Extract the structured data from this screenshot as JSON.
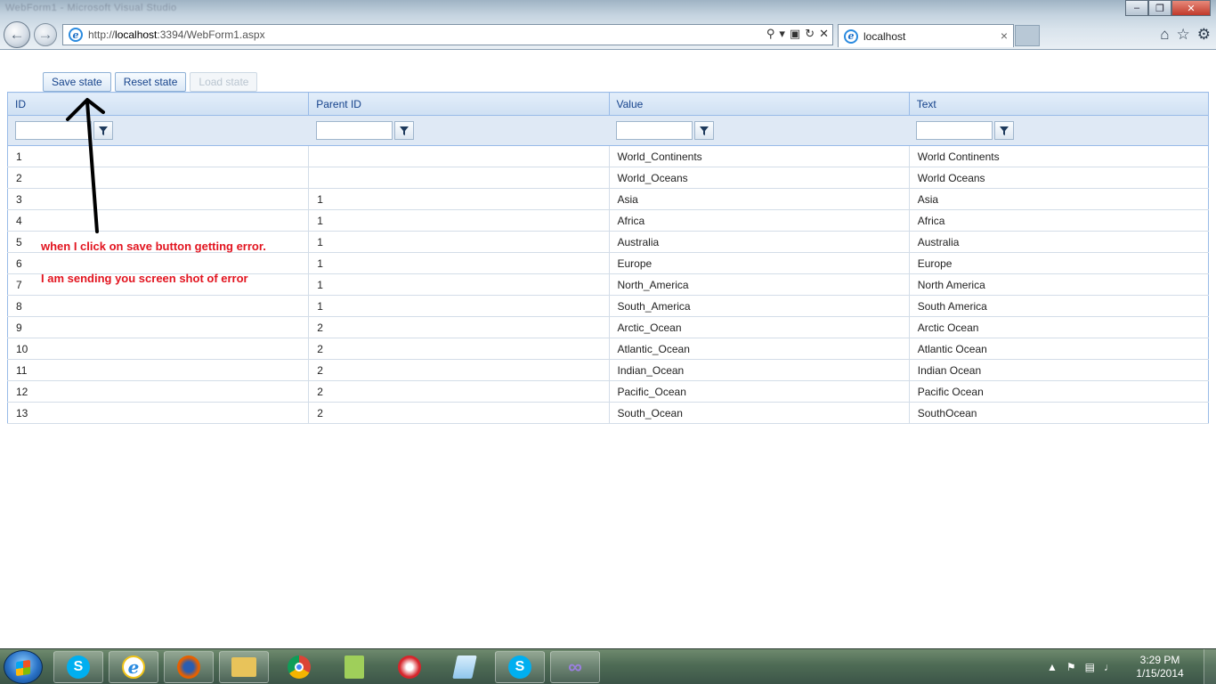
{
  "browser": {
    "blurred_title": "WebForm1 - Microsoft Visual Studio",
    "address": {
      "prefix": "http://",
      "host": "localhost",
      "suffix": ":3394/WebForm1.aspx"
    },
    "tab_title": "localhost",
    "close_glyph": "×"
  },
  "toolbar": {
    "save_label": "Save state",
    "reset_label": "Reset state",
    "load_label": "Load state"
  },
  "grid": {
    "columns": [
      "ID",
      "Parent ID",
      "Value",
      "Text"
    ],
    "rows": [
      [
        "1",
        "",
        "World_Continents",
        "World Continents"
      ],
      [
        "2",
        "",
        "World_Oceans",
        "World Oceans"
      ],
      [
        "3",
        "1",
        "Asia",
        "Asia"
      ],
      [
        "4",
        "1",
        "Africa",
        "Africa"
      ],
      [
        "5",
        "1",
        "Australia",
        "Australia"
      ],
      [
        "6",
        "1",
        "Europe",
        "Europe"
      ],
      [
        "7",
        "1",
        "North_America",
        "North America"
      ],
      [
        "8",
        "1",
        "South_America",
        "South America"
      ],
      [
        "9",
        "2",
        "Arctic_Ocean",
        "Arctic Ocean"
      ],
      [
        "10",
        "2",
        "Atlantic_Ocean",
        "Atlantic Ocean"
      ],
      [
        "11",
        "2",
        "Indian_Ocean",
        "Indian Ocean"
      ],
      [
        "12",
        "2",
        "Pacific_Ocean",
        "Pacific Ocean"
      ],
      [
        "13",
        "2",
        "South_Ocean",
        "SouthOcean"
      ]
    ]
  },
  "annotation": {
    "line1": "when I click on save button getting error.",
    "line2": "I am sending you screen shot of error",
    "color": "#e2141f"
  },
  "taskbar": {
    "clock_time": "3:29 PM",
    "clock_date": "1/15/2014",
    "items": [
      "skype",
      "internet-explorer",
      "firefox",
      "windows-explorer",
      "chrome",
      "notepad-plus-plus",
      "ccleaner",
      "notepad",
      "skype",
      "visual-studio"
    ]
  },
  "colors": {
    "grid_header": "#15428b",
    "grid_border": "#99bbe8",
    "annotation": "#e2141f"
  }
}
